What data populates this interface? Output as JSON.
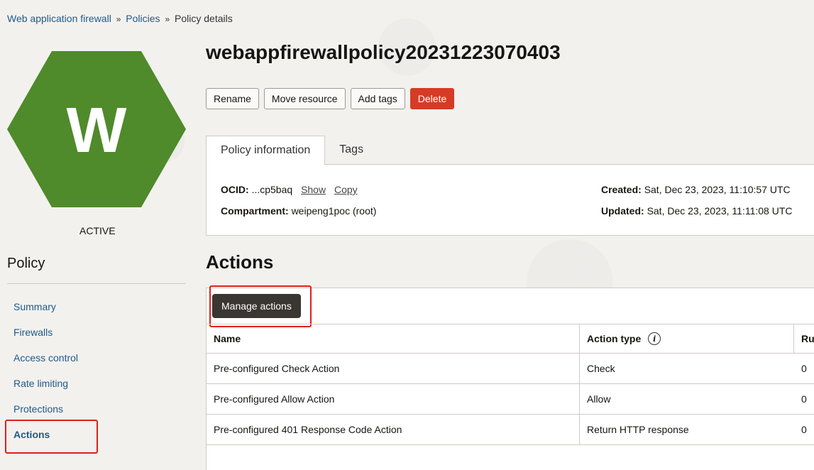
{
  "breadcrumb": {
    "item1": "Web application firewall",
    "item2": "Policies",
    "current": "Policy details",
    "separator": "»"
  },
  "resource": {
    "logo_letter": "W",
    "logo_color": "#4f8a2b",
    "status": "ACTIVE"
  },
  "sidebar": {
    "title": "Policy",
    "items": [
      {
        "label": "Summary"
      },
      {
        "label": "Firewalls"
      },
      {
        "label": "Access control"
      },
      {
        "label": "Rate limiting"
      },
      {
        "label": "Protections"
      },
      {
        "label": "Actions"
      }
    ]
  },
  "page": {
    "title": "webappfirewallpolicy20231223070403"
  },
  "toolbar": {
    "rename": "Rename",
    "move": "Move resource",
    "add_tags": "Add tags",
    "delete": "Delete"
  },
  "tabs": {
    "info": "Policy information",
    "tags": "Tags"
  },
  "info": {
    "ocid_label": "OCID:",
    "ocid_value": "...cp5baq",
    "show": "Show",
    "copy": "Copy",
    "compartment_label": "Compartment:",
    "compartment_value": "weipeng1poc (root)",
    "created_label": "Created:",
    "created_value": "Sat, Dec 23, 2023, 11:10:57 UTC",
    "updated_label": "Updated:",
    "updated_value": "Sat, Dec 23, 2023, 11:11:08 UTC"
  },
  "actions": {
    "title": "Actions",
    "manage_button": "Manage actions",
    "columns": {
      "name": "Name",
      "type": "Action type",
      "third": "Ru"
    },
    "rows": [
      {
        "name": "Pre-configured Check Action",
        "type": "Check",
        "count": "0"
      },
      {
        "name": "Pre-configured Allow Action",
        "type": "Allow",
        "count": "0"
      },
      {
        "name": "Pre-configured 401 Response Code Action",
        "type": "Return HTTP response",
        "count": "0"
      }
    ]
  }
}
